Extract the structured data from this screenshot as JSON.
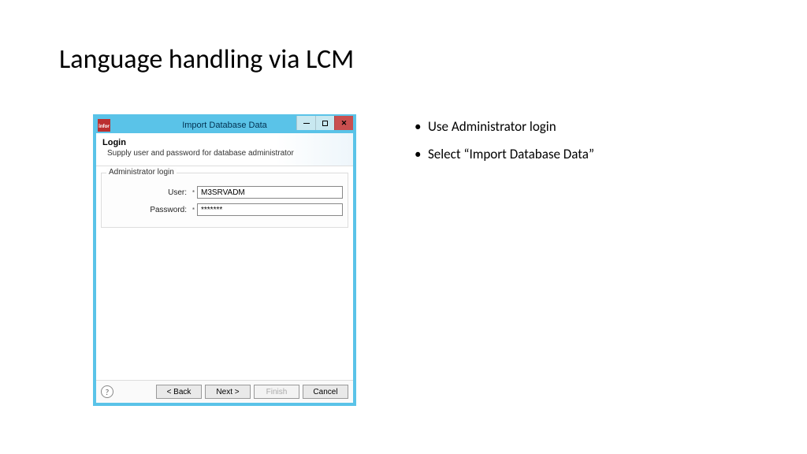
{
  "slide": {
    "title": "Language handling via LCM"
  },
  "bullets": {
    "item1": "Use Administrator login",
    "item2": "Select “Import Database Data”"
  },
  "dialog": {
    "window_title": "Import Database Data",
    "icon_text": "infor",
    "header": {
      "title": "Login",
      "subtitle": "Supply user and password for database administrator"
    },
    "fieldset": {
      "legend": "Administrator login",
      "user_label": "User:",
      "user_value": "M3SRVADM",
      "password_label": "Password:",
      "password_value": "*******"
    },
    "buttons": {
      "back": "< Back",
      "next": "Next >",
      "finish": "Finish",
      "cancel": "Cancel"
    }
  }
}
